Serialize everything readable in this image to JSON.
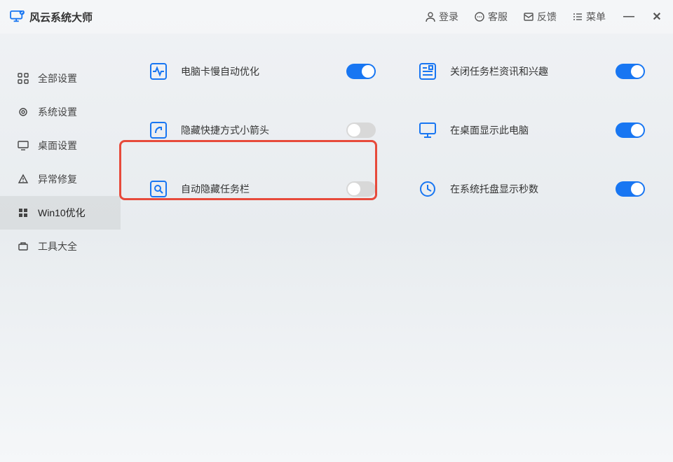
{
  "app": {
    "title": "风云系统大师"
  },
  "header": {
    "login": "登录",
    "service": "客服",
    "feedback": "反馈",
    "menu": "菜单"
  },
  "sidebar": {
    "items": [
      {
        "label": "全部设置"
      },
      {
        "label": "系统设置"
      },
      {
        "label": "桌面设置"
      },
      {
        "label": "异常修复"
      },
      {
        "label": "Win10优化"
      },
      {
        "label": "工具大全"
      }
    ]
  },
  "settings": {
    "left": [
      {
        "label": "电脑卡慢自动优化",
        "on": true
      },
      {
        "label": "隐藏快捷方式小箭头",
        "on": false
      },
      {
        "label": "自动隐藏任务栏",
        "on": false
      }
    ],
    "right": [
      {
        "label": "关闭任务栏资讯和兴趣",
        "on": true
      },
      {
        "label": "在桌面显示此电脑",
        "on": true
      },
      {
        "label": "在系统托盘显示秒数",
        "on": true
      }
    ]
  }
}
